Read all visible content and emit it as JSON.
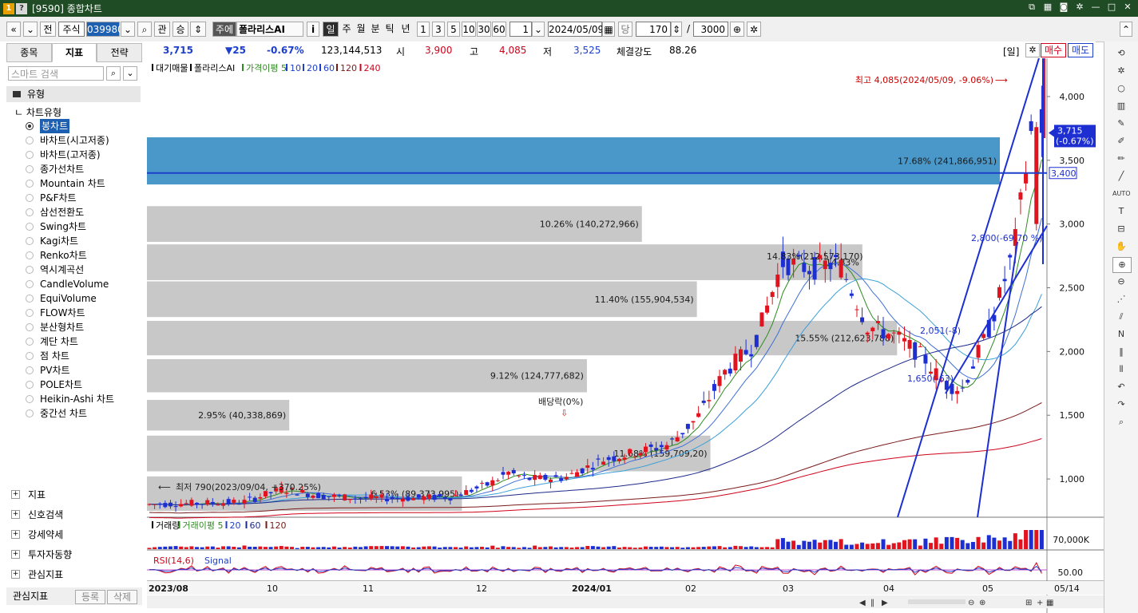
{
  "window": {
    "icon1": "1",
    "icon2": "?",
    "title": "[9590] 종합차트"
  },
  "toolbar": {
    "nav_prev": "«",
    "nav_down": "⌄",
    "prev_btn": "전",
    "type_select": "주식",
    "code": "039980",
    "gwan": "관",
    "seung": "승",
    "stock_type": "주에",
    "stock_name": "폴라리스AI",
    "info": "i",
    "periods": [
      "일",
      "주",
      "월",
      "분",
      "틱",
      "년"
    ],
    "intervals": [
      "1",
      "3",
      "5",
      "10",
      "30",
      "60"
    ],
    "interval_value": "1",
    "date": "2024/05/09",
    "day": "당",
    "count": "170",
    "slash": "/",
    "total": "3000"
  },
  "left_panel": {
    "tabs": [
      "종목",
      "지표",
      "전략"
    ],
    "search_placeholder": "스마트 검색",
    "category": "유형",
    "subcategory": "차트유형",
    "chart_types": [
      "봉차트",
      "바차트(시고저종)",
      "바차트(고저종)",
      "종가선차트",
      "Mountain 차트",
      "P&F차트",
      "삼선전환도",
      "Swing차트",
      "Kagi차트",
      "Renko차트",
      "역시계곡선",
      "CandleVolume",
      "EquiVolume",
      "FLOW차트",
      "분산형차트",
      "계단 차트",
      "점 차트",
      "PV차트",
      "POLE차트",
      "Heikin-Ashi 차트",
      "중간선 차트"
    ],
    "lower_groups": [
      "지표",
      "신호검색",
      "강세약세",
      "투자자동향",
      "관심지표"
    ],
    "fav_label": "관심지표",
    "fav_register": "등록",
    "fav_delete": "삭제"
  },
  "price_bar": {
    "price": "3,715",
    "change": "▼25",
    "change_pct": "-0.67%",
    "volume": "123,144,513",
    "open_label": "시",
    "open": "3,900",
    "high_label": "고",
    "high": "4,085",
    "low_label": "저",
    "low": "3,525",
    "strength_label": "체결강도",
    "strength": "88.26",
    "period_tag": "[일]",
    "buy": "매수",
    "sell": "매도"
  },
  "chart_data": [
    {
      "type": "candlestick",
      "legend": [
        "대기매물",
        "폴라리스AI",
        "가격이평 5",
        "10",
        "20",
        "60",
        "120",
        "240"
      ],
      "ylim": [
        700,
        4300
      ],
      "y_ticks": [
        "1,000",
        "1,500",
        "2,000",
        "2,500",
        "3,000",
        "3,500",
        "4,000"
      ],
      "x_ticks": [
        "2023/08",
        "10",
        "11",
        "12",
        "2024/01",
        "02",
        "03",
        "04",
        "05"
      ],
      "last_date": "05/14",
      "current_price_label": "3,715",
      "current_change_label": "(-0.67%)",
      "hline_label": "3,400",
      "hline_value": 3400,
      "max_annotation": "최고 4,085(2024/05/09, -9.06%)",
      "min_annotation": "최저 790(2023/09/04, +370.25%)",
      "dividend_annotation": "배당락(0%)",
      "price_labels": [
        "2,800(-69.70 %)",
        "2,051(-8)",
        "1,650(-63)",
        "14.83%(212,573,170)"
      ],
      "volume_profile": [
        {
          "label": "6.53% (89,373,995)",
          "low": 750,
          "high": 1020,
          "pct": 6.53
        },
        {
          "label": "11.68% (159,709,20)",
          "low": 1060,
          "high": 1340,
          "pct": 11.68
        },
        {
          "label": "2.95% (40,338,869)",
          "low": 1380,
          "high": 1620,
          "pct": 2.95
        },
        {
          "label": "9.12% (124,777,682)",
          "low": 1680,
          "high": 1940,
          "pct": 9.12
        },
        {
          "label": "15.55% (212,623,788)",
          "low": 1970,
          "high": 2240,
          "pct": 15.55
        },
        {
          "label": "11.40% (155,904,534)",
          "low": 2270,
          "high": 2550,
          "pct": 11.4
        },
        {
          "label": "14.83%",
          "low": 2560,
          "high": 2840,
          "pct": 14.83
        },
        {
          "label": "10.26% (140,272,966)",
          "low": 2860,
          "high": 3140,
          "pct": 10.26
        },
        {
          "label": "17.68% (241,866,951)",
          "low": 3310,
          "high": 3680,
          "pct": 17.68,
          "highlight": true
        }
      ]
    },
    {
      "type": "bar",
      "legend": [
        "거래량",
        "거래이평 5",
        "20",
        "60",
        "120"
      ],
      "y_tick": "70,000K"
    },
    {
      "type": "line",
      "legend": [
        "RSI(14,6)",
        "Signal"
      ],
      "y_tick": "50.00"
    }
  ]
}
